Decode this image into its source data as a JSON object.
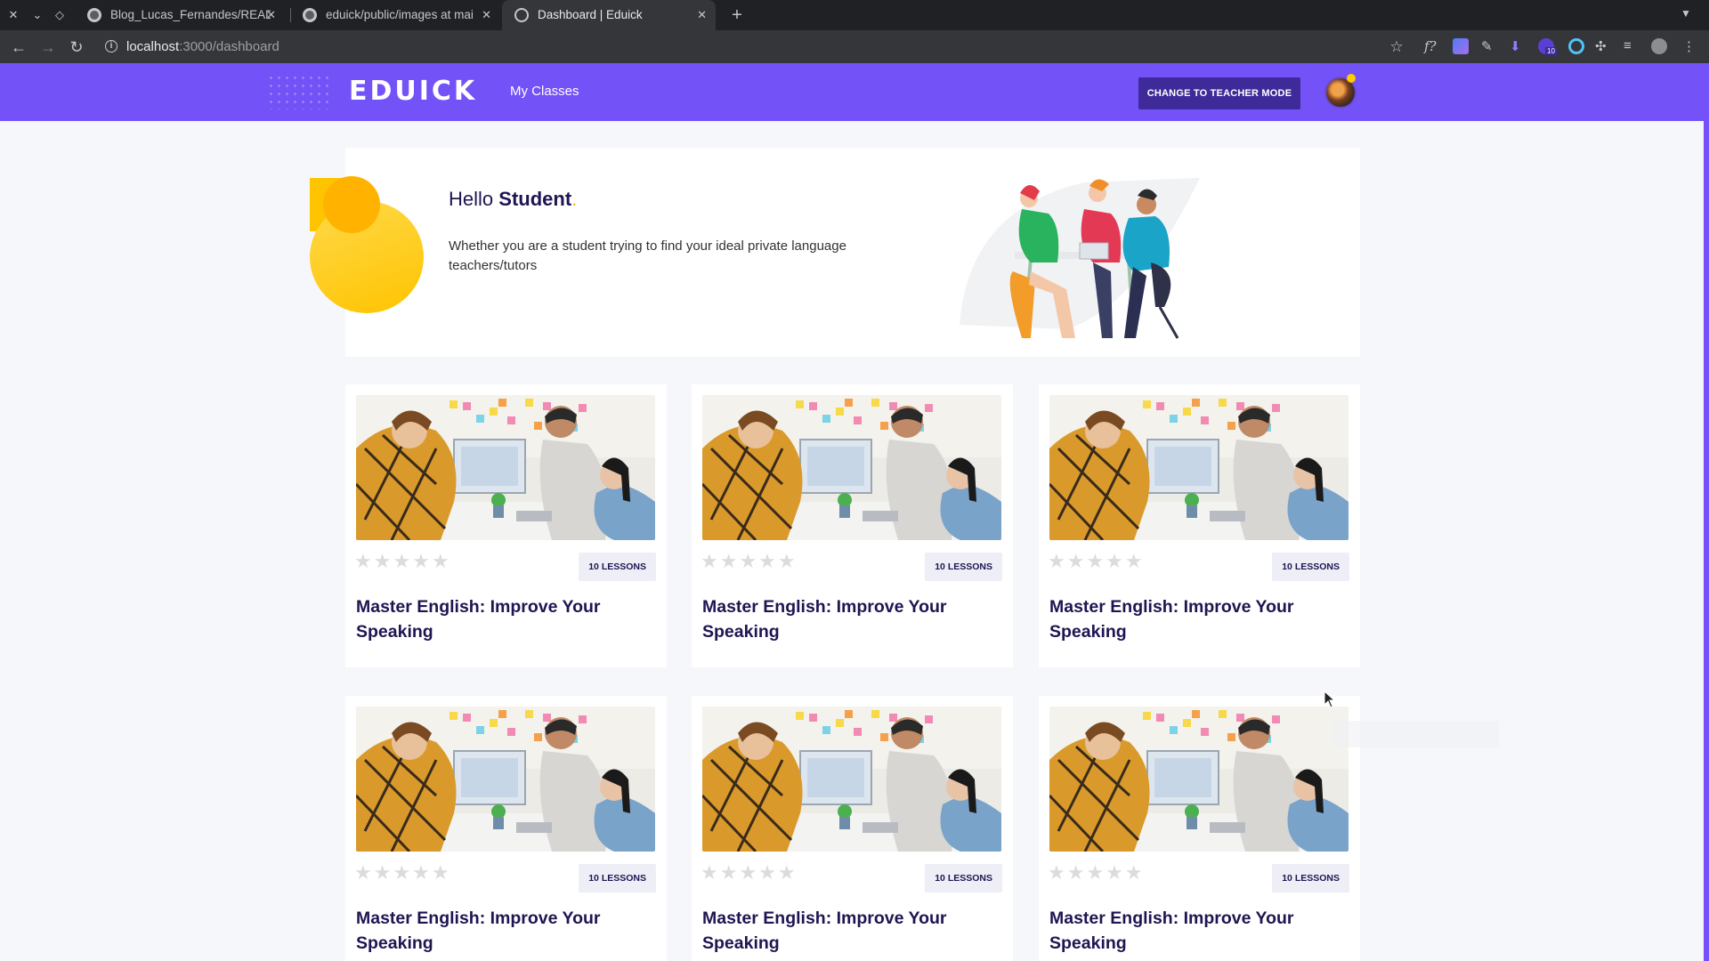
{
  "browser": {
    "tabs": [
      {
        "title": "Blog_Lucas_Fernandes/READ",
        "icon": "github-icon",
        "active": false
      },
      {
        "title": "eduick/public/images at mai",
        "icon": "github-icon",
        "active": false
      },
      {
        "title": "Dashboard | Eduick",
        "icon": "globe-icon",
        "active": true
      }
    ],
    "url_host": "localhost",
    "url_path": ":3000/dashboard",
    "extension_badge": "10"
  },
  "header": {
    "logo": "EDUICK",
    "nav": [
      "My Classes"
    ],
    "mode_button": "CHANGE TO TEACHER MODE"
  },
  "hero": {
    "greeting": "Hello",
    "name": "Student",
    "punct": ".",
    "text": "Whether you are a student trying to find your ideal private language teachers/tutors"
  },
  "courses": [
    {
      "title": "Master English: Improve Your Speaking",
      "lessons": "10 LESSONS",
      "rating": 0
    },
    {
      "title": "Master English: Improve Your Speaking",
      "lessons": "10 LESSONS",
      "rating": 0
    },
    {
      "title": "Master English: Improve Your Speaking",
      "lessons": "10 LESSONS",
      "rating": 0
    },
    {
      "title": "Master English: Improve Your Speaking",
      "lessons": "10 LESSONS",
      "rating": 0
    },
    {
      "title": "Master English: Improve Your Speaking",
      "lessons": "10 LESSONS",
      "rating": 0
    },
    {
      "title": "Master English: Improve Your Speaking",
      "lessons": "10 LESSONS",
      "rating": 0
    }
  ],
  "colors": {
    "brand": "#7352f7",
    "button": "#3f2a9a",
    "title": "#1f1552",
    "accent": "#ffc400"
  }
}
